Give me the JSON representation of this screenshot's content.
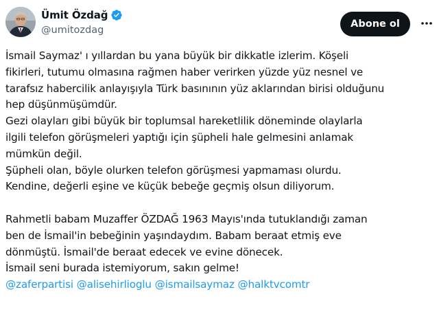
{
  "author": {
    "display_name": "Ümit Özdağ",
    "handle": "@umitozdag",
    "verified": true
  },
  "actions": {
    "follow_label": "Abone ol",
    "more_icon": "more-dots-icon"
  },
  "tweet": {
    "paragraph1": [
      "İsmail Saymaz' ı yıllardan bu yana büyük bir dikkatle izlerim. Köşeli",
      "fikirleri, tutumu olmasına rağmen haber verirken yüzde yüz nesnel ve",
      "tarafsız habercilik anlayışıyla Türk basınının yüz aklarından birisi olduğunu",
      "hep düşünmüşümdür.",
      "Gezi olayları gibi büyük bir toplumsal hareketlilik döneminde olaylarla",
      "ilgili telefon görüşmeleri yaptığı için şüpheli hale gelmesini anlamak",
      "mümkün değil.",
      "Şüpheli olan, böyle olurken telefon görüşmesi yapmaması olurdu.",
      "Kendine, değerli eşine ve küçük bebeğe geçmiş olsun diliyorum."
    ],
    "paragraph2": [
      "Rahmetli babam Muzaffer ÖZDAĞ 1963 Mayıs'ında tutuklandığı zaman",
      "ben de İsmail'in bebeğinin yaşındaydım. Babam beraat etmiş eve",
      "dönmüştü. İsmail'de beraat edecek ve evine dönecek.",
      "İsmail seni burada istemiyorum, sakın gelme!"
    ],
    "mentions": [
      "@zaferpartisi",
      "@alisehirlioglu",
      "@ismailsaymaz",
      "@halktvcomtr"
    ]
  },
  "colors": {
    "link": "#1d9bf0",
    "verified_badge": "#1d9bf0",
    "button_bg": "#0f1419",
    "text": "#0f1419",
    "secondary_text": "#536471"
  }
}
